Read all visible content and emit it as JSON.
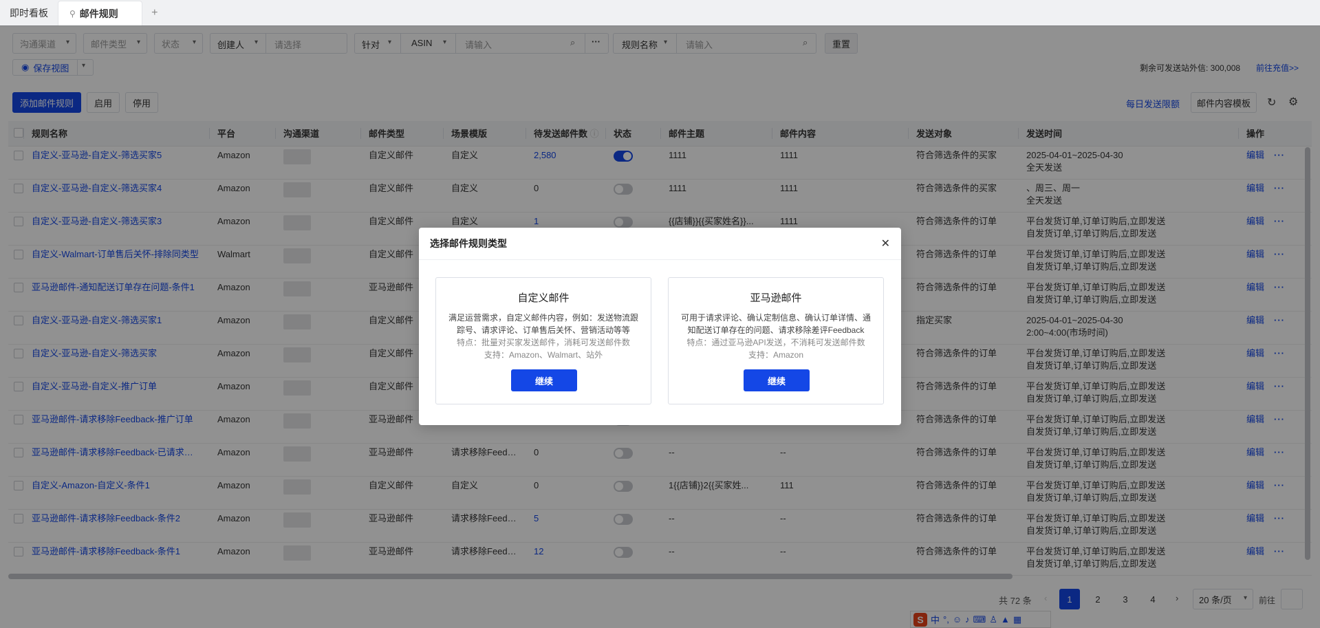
{
  "tabs": [
    {
      "label": "即时看板",
      "active": false
    },
    {
      "label": "邮件规则",
      "active": true
    }
  ],
  "filters": {
    "channel": "沟通渠道",
    "mail_type": "邮件类型",
    "status": "状态",
    "creator": "创建人",
    "creator_placeholder": "请选择",
    "target": "针对",
    "asin": "ASIN",
    "asin_placeholder": "请输入",
    "rule_name": "规则名称",
    "rule_name_placeholder": "请输入",
    "reset": "重置",
    "save_view": "保存视图"
  },
  "quota": {
    "label": "剩余可发送站外信: 300,008",
    "recharge": "前往充值>>"
  },
  "toolbar": {
    "add_rule": "添加邮件规则",
    "enable": "启用",
    "disable": "停用",
    "daily_limit": "每日发送限额",
    "content_template": "邮件内容模板"
  },
  "columns": [
    "规则名称",
    "平台",
    "沟通渠道",
    "邮件类型",
    "场景模版",
    "待发送邮件数",
    "状态",
    "邮件主题",
    "邮件内容",
    "发送对象",
    "发送时间",
    "操作"
  ],
  "rows": [
    {
      "name": "自定义-亚马逊-自定义-筛选买家5",
      "platform": "Amazon",
      "type": "自定义邮件",
      "scene": "自定义",
      "pending": "2,580",
      "on": true,
      "subject": "1111",
      "content": "1111",
      "target": "符合筛选条件的买家",
      "time1": "2025-04-01~2025-04-30",
      "time2": "全天发送"
    },
    {
      "name": "自定义-亚马逊-自定义-筛选买家4",
      "platform": "Amazon",
      "type": "自定义邮件",
      "scene": "自定义",
      "pending": "0",
      "on": false,
      "subject": "1111",
      "content": "1111",
      "target": "符合筛选条件的买家",
      "time1": "、周三、周一",
      "time2": "全天发送"
    },
    {
      "name": "自定义-亚马逊-自定义-筛选买家3",
      "platform": "Amazon",
      "type": "自定义邮件",
      "scene": "自定义",
      "pending": "1",
      "on": false,
      "subject": "{{店铺}}{{买家姓名}}...",
      "content": "1111",
      "target": "符合筛选条件的订单",
      "time1": "平台发货订单,订单订购后,立即发送",
      "time2": "自发货订单,订单订购后,立即发送"
    },
    {
      "name": "自定义-Walmart-订单售后关怀-排除同类型",
      "platform": "Walmart",
      "type": "自定义邮件",
      "scene": "",
      "pending": "",
      "on": false,
      "subject": "",
      "content": "",
      "target": "符合筛选条件的订单",
      "time1": "平台发货订单,订单订购后,立即发送",
      "time2": "自发货订单,订单订购后,立即发送"
    },
    {
      "name": "亚马逊邮件-通知配送订单存在问题-条件1",
      "platform": "Amazon",
      "type": "亚马逊邮件",
      "scene": "",
      "pending": "",
      "on": false,
      "subject": "",
      "content": "",
      "target": "符合筛选条件的订单",
      "time1": "平台发货订单,订单订购后,立即发送",
      "time2": "自发货订单,订单订购后,立即发送"
    },
    {
      "name": "自定义-亚马逊-自定义-筛选买家1",
      "platform": "Amazon",
      "type": "自定义邮件",
      "scene": "",
      "pending": "",
      "on": false,
      "subject": "",
      "content": "",
      "target": "指定买家",
      "time1": "2025-04-01~2025-04-30",
      "time2": "2:00~4:00(市场时间)"
    },
    {
      "name": "自定义-亚马逊-自定义-筛选买家",
      "platform": "Amazon",
      "type": "自定义邮件",
      "scene": "",
      "pending": "",
      "on": false,
      "subject": "",
      "content": "",
      "target": "符合筛选条件的订单",
      "time1": "平台发货订单,订单订购后,立即发送",
      "time2": "自发货订单,订单订购后,立即发送"
    },
    {
      "name": "自定义-亚马逊-自定义-推广订单",
      "platform": "Amazon",
      "type": "自定义邮件",
      "scene": "",
      "pending": "",
      "on": false,
      "subject": "",
      "content": "",
      "target": "符合筛选条件的订单",
      "time1": "平台发货订单,订单订购后,立即发送",
      "time2": "自发货订单,订单订购后,立即发送"
    },
    {
      "name": "亚马逊邮件-请求移除Feedback-推广订单",
      "platform": "Amazon",
      "type": "亚马逊邮件",
      "scene": "",
      "pending": "",
      "on": false,
      "subject": "",
      "content": "",
      "target": "符合筛选条件的订单",
      "time1": "平台发货订单,订单订购后,立即发送",
      "time2": "自发货订单,订单订购后,立即发送"
    },
    {
      "name": "亚马逊邮件-请求移除Feedback-已请求评论",
      "platform": "Amazon",
      "type": "亚马逊邮件",
      "scene": "请求移除Feedba...",
      "pending": "0",
      "on": false,
      "subject": "--",
      "content": "--",
      "target": "符合筛选条件的订单",
      "time1": "平台发货订单,订单订购后,立即发送",
      "time2": "自发货订单,订单订购后,立即发送"
    },
    {
      "name": "自定义-Amazon-自定义-条件1",
      "platform": "Amazon",
      "type": "自定义邮件",
      "scene": "自定义",
      "pending": "0",
      "on": false,
      "subject": "1{{店铺}}2{{买家姓...",
      "content": "111",
      "target": "符合筛选条件的订单",
      "time1": "平台发货订单,订单订购后,立即发送",
      "time2": "自发货订单,订单订购后,立即发送"
    },
    {
      "name": "亚马逊邮件-请求移除Feedback-条件2",
      "platform": "Amazon",
      "type": "亚马逊邮件",
      "scene": "请求移除Feedba...",
      "pending": "5",
      "on": false,
      "subject": "--",
      "content": "--",
      "target": "符合筛选条件的订单",
      "time1": "平台发货订单,订单订购后,立即发送",
      "time2": "自发货订单,订单订购后,立即发送"
    },
    {
      "name": "亚马逊邮件-请求移除Feedback-条件1",
      "platform": "Amazon",
      "type": "亚马逊邮件",
      "scene": "请求移除Feedba...",
      "pending": "12",
      "on": false,
      "subject": "--",
      "content": "--",
      "target": "符合筛选条件的订单",
      "time1": "平台发货订单,订单订购后,立即发送",
      "time2": "自发货订单,订单订购后,立即发送"
    }
  ],
  "row_actions": {
    "edit": "编辑",
    "more": "···"
  },
  "pagination": {
    "total": "共 72 条",
    "pages": [
      "1",
      "2",
      "3",
      "4"
    ],
    "current": "1",
    "page_size": "20 条/页",
    "goto_label": "前往"
  },
  "ime": {
    "logo": "S",
    "lang": "中",
    "punct": "°,"
  },
  "modal": {
    "title": "选择邮件规则类型",
    "cards": [
      {
        "title": "自定义邮件",
        "desc": "满足运营需求，自定义邮件内容，例如：发送物流跟踪号、请求评论、订单售后关怀、营销活动等等",
        "feature": "特点：批量对买家发送邮件，消耗可发送邮件数",
        "support": "支持：Amazon、Walmart、站外",
        "button": "继续"
      },
      {
        "title": "亚马逊邮件",
        "desc": "可用于请求评论、确认定制信息、确认订单详情、通知配送订单存在的问题、请求移除差评Feedback",
        "feature": "特点：通过亚马逊API发送，不消耗可发送邮件数",
        "support": "支持：Amazon",
        "button": "继续"
      }
    ]
  },
  "colors": {
    "primary": "#1447e6",
    "overlay": "rgba(0,0,0,0.43)"
  }
}
